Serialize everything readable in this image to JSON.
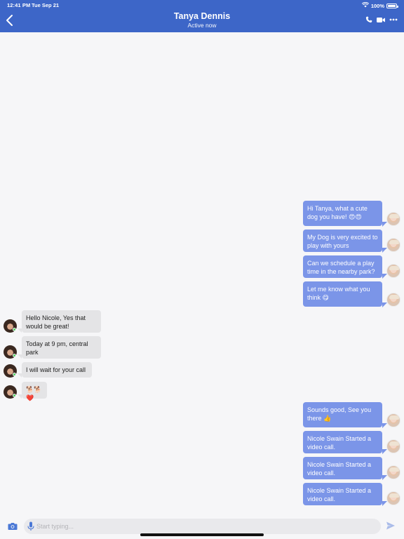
{
  "status_bar": {
    "time": "12:41 PM",
    "date": "Tue Sep 21",
    "battery": "100%"
  },
  "header": {
    "title": "Tanya Dennis",
    "subtitle": "Active now"
  },
  "messages": [
    {
      "side": "out",
      "text": "Hi Tanya, what a cute dog you have! 😍😍"
    },
    {
      "side": "out",
      "text": "My Dog is very excited to play with yours"
    },
    {
      "side": "out",
      "text": "Can we schedule a play time in the nearby park?"
    },
    {
      "side": "out",
      "text": "Let me know what you think 😋"
    },
    {
      "side": "in",
      "text": "Hello Nicole, Yes that would be great!"
    },
    {
      "side": "in",
      "text": "Today at 9 pm, central park"
    },
    {
      "side": "in",
      "text": "I will wait for your call"
    },
    {
      "side": "in",
      "text": "🐕🐕❤️"
    },
    {
      "side": "out",
      "text": "Sounds good, See you there 👍"
    },
    {
      "side": "out",
      "text": "Nicole Swain Started a video call."
    },
    {
      "side": "out",
      "text": "Nicole Swain Started a video call."
    },
    {
      "side": "out",
      "text": "Nicole Swain Started a video call."
    }
  ],
  "composer": {
    "placeholder": "Start typing..."
  },
  "icons": {
    "back": "chevron-left-icon",
    "phone": "phone-icon",
    "video": "video-camera-icon",
    "more": "more-horizontal-icon",
    "camera": "camera-icon",
    "mic": "microphone-icon",
    "send": "send-icon",
    "wifi": "wifi-icon",
    "battery": "battery-icon"
  },
  "colors": {
    "header": "#3d66c8",
    "outgoing_bubble": "#7b95e8",
    "incoming_bubble": "#e4e4e6",
    "online": "#4fce5d"
  }
}
